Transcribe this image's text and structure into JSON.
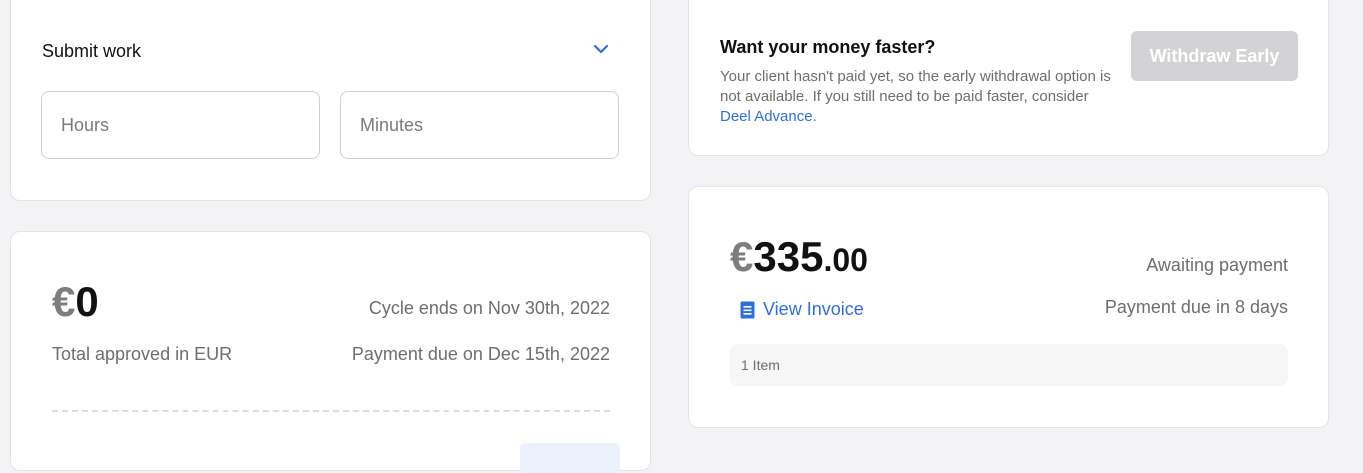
{
  "submit_work": {
    "title": "Submit work",
    "hours_placeholder": "Hours",
    "minutes_placeholder": "Minutes"
  },
  "total": {
    "currency": "€",
    "amount": "0",
    "label": "Total approved in EUR",
    "cycle_ends": "Cycle ends on Nov 30th, 2022",
    "payment_due": "Payment due on Dec 15th, 2022"
  },
  "withdraw": {
    "title": "Want your money faster?",
    "text_before_link": "Your client hasn't paid yet, so the early withdrawal option is not available. If you still need to be paid faster, consider ",
    "link_text": "Deel Advance",
    "text_after_link": ".",
    "button_label": "Withdraw Early"
  },
  "invoice": {
    "currency": "€",
    "amount_whole": "335",
    "amount_cents": ".00",
    "view_invoice_label": "View Invoice",
    "status": "Awaiting payment",
    "payment_due": "Payment due in 8 days",
    "items_label": "1 Item"
  },
  "icons": {
    "chevron": "chevron-down-icon",
    "invoice": "document-icon"
  },
  "colors": {
    "accent": "#2f6fdc",
    "disabled_button": "#d3d3d5",
    "background": "#f3f3f5"
  }
}
